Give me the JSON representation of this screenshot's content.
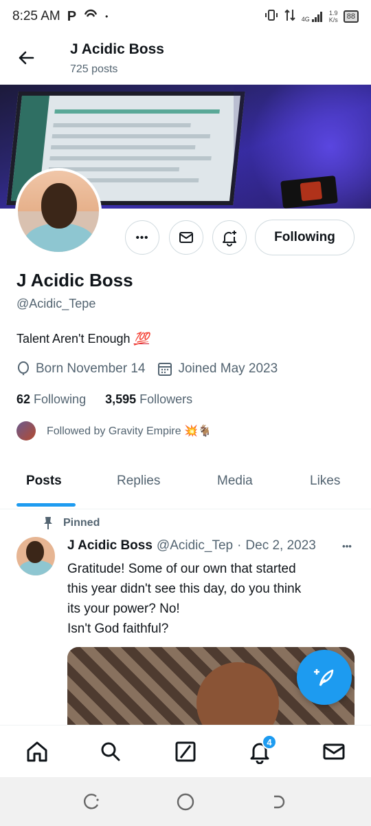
{
  "status_bar": {
    "time": "8:25 AM",
    "app_icon_1": "P",
    "dot": "•",
    "network": "4G",
    "speed_value": "1.9",
    "speed_unit": "K/s",
    "battery": "88"
  },
  "header": {
    "name": "J Acidic Boss",
    "posts_count": "725 posts"
  },
  "profile": {
    "display_name": "J Acidic Boss",
    "handle": "@Acidic_Tepe",
    "bio_text": "Talent Aren't Enough ",
    "bio_emoji": "💯",
    "born": "Born November 14",
    "joined": "Joined May 2023",
    "following_count": "62",
    "following_label": "Following",
    "followers_count": "3,595",
    "followers_label": "Followers",
    "followed_by": "Followed by Gravity Empire 💥🐐",
    "follow_button": "Following",
    "more_label": "•••"
  },
  "tabs": [
    {
      "label": "Posts",
      "active": true
    },
    {
      "label": "Replies",
      "active": false
    },
    {
      "label": "Media",
      "active": false
    },
    {
      "label": "Likes",
      "active": false
    }
  ],
  "tweet": {
    "pinned_label": "Pinned",
    "author_name": "J Acidic Boss",
    "author_handle": "@Acidic_Tep",
    "separator": "·",
    "date": "Dec 2, 2023",
    "more": "•••",
    "text": "Gratitude! Some of our own that started\nthis year  didn't see this day, do you think\nits your power? No!\nIsn't God faithful?"
  },
  "bottom_nav": {
    "items": [
      "home-icon",
      "search-icon",
      "grok-icon",
      "notifications-icon",
      "messages-icon"
    ],
    "notification_badge": "4"
  },
  "colors": {
    "accent": "#1d9bf0",
    "text_primary": "#0f1419",
    "text_secondary": "#536471",
    "border": "#cfd9de"
  }
}
